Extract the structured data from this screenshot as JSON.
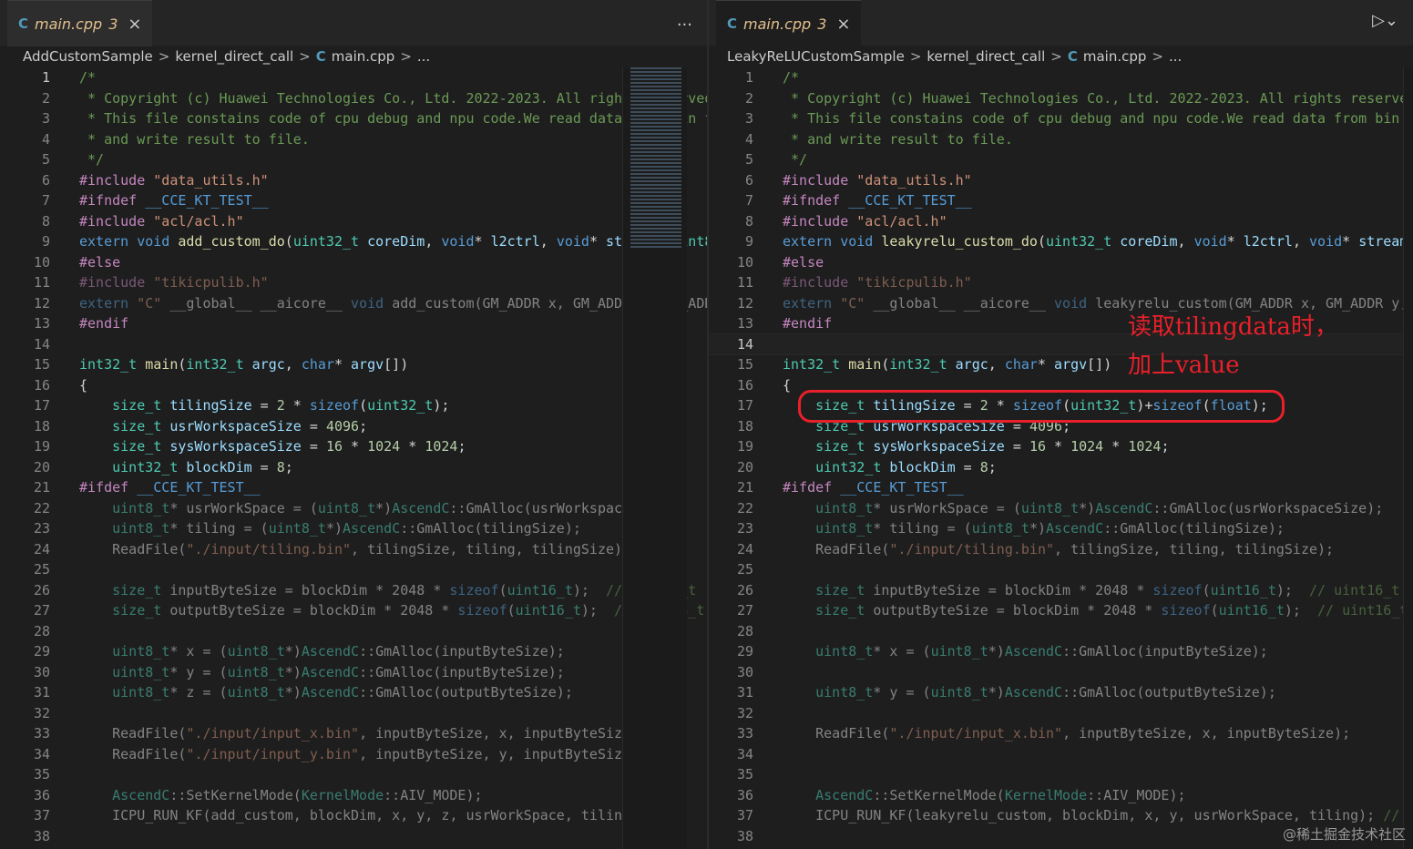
{
  "left": {
    "tab": {
      "icon": "cpp-file-icon",
      "label": "main.cpp",
      "problem_count": "3",
      "close": "×"
    },
    "tab_actions": "...",
    "breadcrumb": [
      "AddCustomSample",
      "kernel_direct_call",
      "main.cpp",
      "..."
    ],
    "active_line": 1
  },
  "right": {
    "tab": {
      "icon": "cpp-file-icon",
      "label": "main.cpp",
      "problem_count": "3",
      "close": "×"
    },
    "breadcrumb": [
      "LeakyReLUCustomSample",
      "kernel_direct_call",
      "main.cpp",
      "..."
    ],
    "active_line": 14
  },
  "annotation": {
    "line1": "读取tilingdata时，",
    "line2": "加上value",
    "colors": {
      "box": "#e8202a"
    }
  },
  "watermark": "@稀土掘金技术社区",
  "colors": {
    "background": "#1e1e1e",
    "comment": "#6a9955",
    "keyword": "#569cd6",
    "type": "#4ec9b0",
    "function": "#dcdcaa",
    "string": "#ce9178"
  }
}
